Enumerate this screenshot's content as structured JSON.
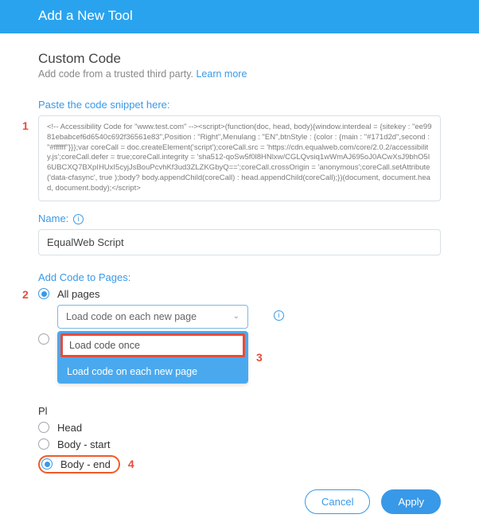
{
  "header": {
    "title": "Add a New Tool"
  },
  "section": {
    "title": "Custom Code",
    "subtitle_prefix": "Add code from a trusted third party. ",
    "learn_more": "Learn more"
  },
  "snippet": {
    "label": "Paste the code snippet here:",
    "value": "<!-- Accessibility Code for \"www.test.com\" --><script>(function(doc, head, body){window.interdeal = {sitekey : \"ee9981ebabcef6d6540c692f36561e83\",Position : \"Right\",Menulang : \"EN\",btnStyle : {color : {main : \"#171d2d\",second : \"#ffffff\"}}};var coreCall = doc.createElement('script');coreCall.src = 'https://cdn.equalweb.com/core/2.0.2/accessibility.js';coreCall.defer = true;coreCall.integrity = 'sha512-qoSw5f0l8HNlxw/CGLQvsiq1wWmAJ695oJ0ACwXsJ9bhO5I6UBCXQ7BXpIHUxI5cyjJsBouPcvhKf3ud3ZLZKGbyQ==';coreCall.crossOrigin = 'anonymous';coreCall.setAttribute('data-cfasync', true );body? body.appendChild(coreCall) : head.appendChild(coreCall);})(document, document.head, document.body);</script>"
  },
  "name": {
    "label": "Name:",
    "value": "EqualWeb Script"
  },
  "pages": {
    "label": "Add Code to Pages:",
    "options": {
      "all": "All pages",
      "choose": ""
    },
    "select": {
      "selected": "Load code on each new page",
      "items": [
        "Load code once",
        "Load code on each new page"
      ]
    }
  },
  "placement": {
    "label_partial": "Pl",
    "options": {
      "head": "Head",
      "body_start": "Body - start",
      "body_end": "Body - end"
    }
  },
  "annotations": {
    "a1": "1",
    "a2": "2",
    "a3": "3",
    "a4": "4"
  },
  "buttons": {
    "cancel": "Cancel",
    "apply": "Apply"
  },
  "glyphs": {
    "info": "i",
    "chevron": "⌄"
  }
}
